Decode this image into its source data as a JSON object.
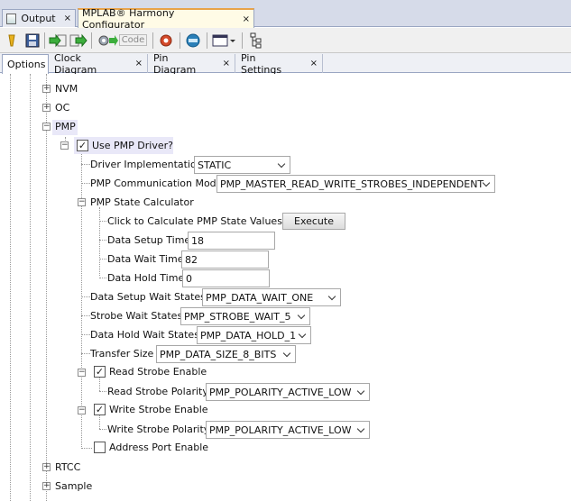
{
  "doc_tabs": [
    {
      "label": "Output",
      "close": "×"
    },
    {
      "label": "MPLAB® Harmony Configurator",
      "close": "×"
    }
  ],
  "toolbar": {
    "code_label": "Code"
  },
  "view_tabs": [
    {
      "label": "Options"
    },
    {
      "label": "Clock Diagram",
      "close": "×"
    },
    {
      "label": "Pin Diagram",
      "close": "×"
    },
    {
      "label": "Pin Settings",
      "close": "×"
    }
  ],
  "tree": {
    "nvm": "NVM",
    "oc": "OC",
    "pmp": "PMP",
    "use_pmp_driver": {
      "label": "Use PMP Driver?",
      "checked": "✓"
    },
    "driver_impl": {
      "label": "Driver Implementation",
      "value": "STATIC"
    },
    "comm_mode": {
      "label": "PMP Communication Mode",
      "value": "PMP_MASTER_READ_WRITE_STROBES_INDEPENDENT"
    },
    "state_calc": {
      "label": "PMP State Calculator"
    },
    "calc_values": {
      "label": "Click to Calculate PMP State Values",
      "button": "Execute"
    },
    "data_setup_time": {
      "label": "Data Setup Time",
      "value": "18"
    },
    "data_wait_time": {
      "label": "Data Wait Time",
      "value": "82"
    },
    "data_hold_time": {
      "label": "Data Hold Time",
      "value": "0"
    },
    "data_setup_wait_states": {
      "label": "Data Setup Wait States",
      "value": "PMP_DATA_WAIT_ONE"
    },
    "strobe_wait_states": {
      "label": "Strobe Wait States",
      "value": "PMP_STROBE_WAIT_5"
    },
    "data_hold_wait_states": {
      "label": "Data Hold Wait States",
      "value": "PMP_DATA_HOLD_1"
    },
    "transfer_size": {
      "label": "Transfer Size",
      "value": "PMP_DATA_SIZE_8_BITS"
    },
    "read_strobe_enable": {
      "label": "Read Strobe Enable",
      "checked": "✓"
    },
    "read_strobe_polarity": {
      "label": "Read Strobe Polarity",
      "value": "PMP_POLARITY_ACTIVE_LOW"
    },
    "write_strobe_enable": {
      "label": "Write Strobe Enable",
      "checked": "✓"
    },
    "write_strobe_polarity": {
      "label": "Write Strobe Polarity",
      "value": "PMP_POLARITY_ACTIVE_LOW"
    },
    "address_port_enable": {
      "label": "Address Port Enable",
      "checked": ""
    },
    "rtcc": "RTCC",
    "sample": "Sample"
  },
  "colors": {
    "active_tab_accent": "#e8a34a",
    "selection_highlight": "#e9e8f8"
  }
}
